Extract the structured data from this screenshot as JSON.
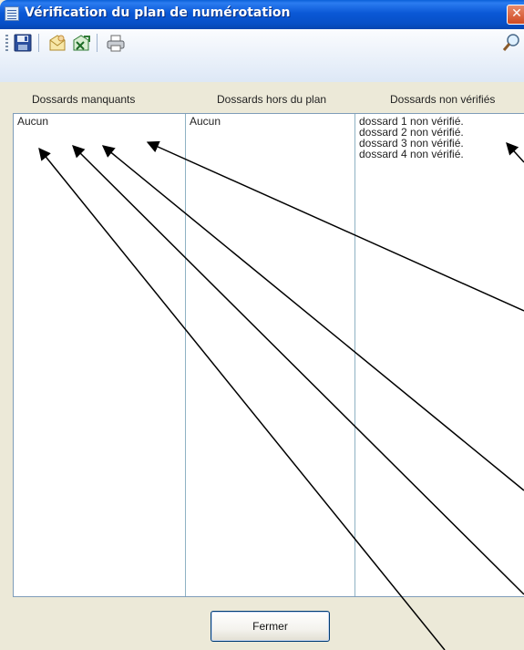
{
  "window": {
    "title": "Vérification du plan de numérotation",
    "close_symbol": "✕"
  },
  "toolbar": {
    "buttons": [
      {
        "icon": "save-icon"
      },
      {
        "icon": "email-icon"
      },
      {
        "icon": "excel-export-icon"
      },
      {
        "icon": "print-icon"
      }
    ],
    "search_icon": "magnifier-icon"
  },
  "columns": [
    {
      "header": "Dossards manquants",
      "lines": [
        "Aucun"
      ]
    },
    {
      "header": "Dossards hors du plan",
      "lines": [
        "Aucun"
      ]
    },
    {
      "header": "Dossards non vérifiés",
      "lines": [
        "dossard 1 non vérifié.",
        "dossard 2 non vérifié.",
        "dossard 3 non vérifié.",
        "dossard 4 non vérifié."
      ]
    }
  ],
  "footer": {
    "close_button_label": "Fermer"
  },
  "colors": {
    "titlebar": "#0a58d6",
    "panel_border": "#7f9db9",
    "column_divider": "#8fb2c4",
    "annotation_arrows": "#000000"
  }
}
